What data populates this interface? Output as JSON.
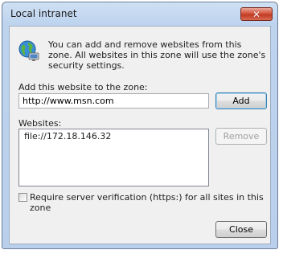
{
  "window": {
    "title": "Local intranet",
    "close_glyph": "✕"
  },
  "intro": {
    "icon": "intranet-globe-icon",
    "text": "You can add and remove websites from this zone. All websites in this zone will use the zone's security settings."
  },
  "add_section": {
    "label": "Add this website to the zone:",
    "value": "http://www.msn.com",
    "add_button": "Add"
  },
  "websites": {
    "label": "Websites:",
    "items": [
      "file://172.18.146.32"
    ],
    "remove_button": "Remove"
  },
  "verification": {
    "label": "Require server verification (https:) for all sites in this zone",
    "checked": false
  },
  "footer": {
    "close_button": "Close"
  },
  "colors": {
    "titlebar": "#bdd3ee",
    "close_button": "#c13a23",
    "client_background": "#f0f0f0"
  }
}
